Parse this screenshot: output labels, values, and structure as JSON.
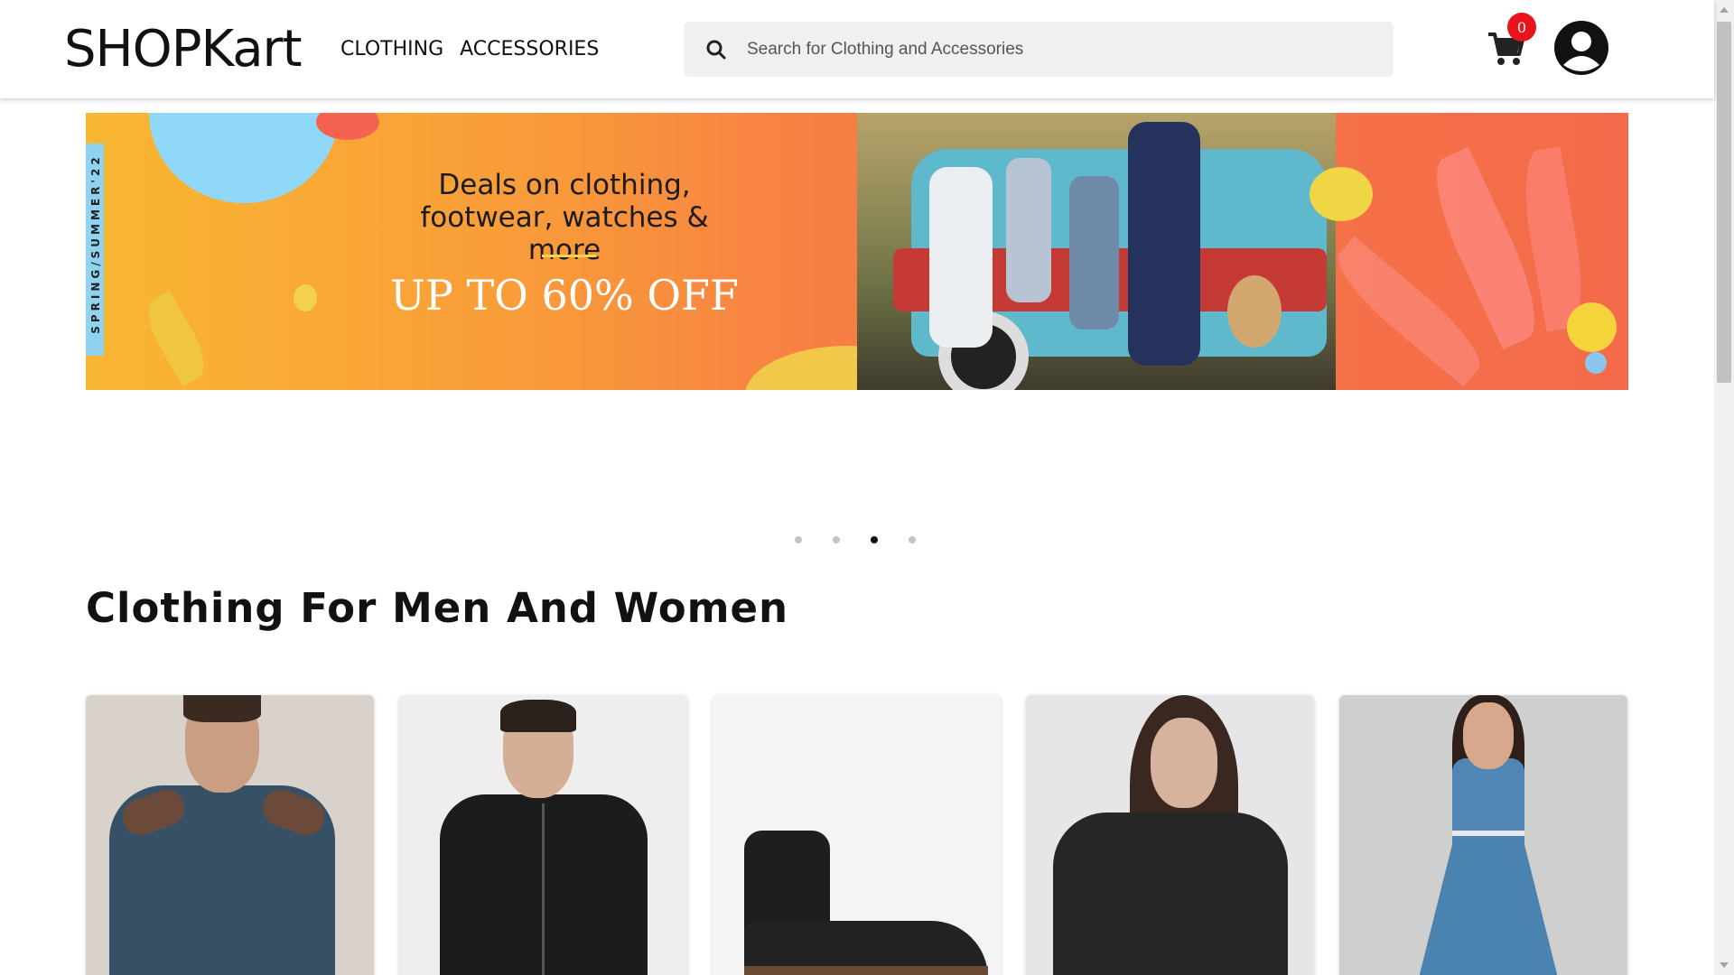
{
  "header": {
    "logo": "SHOPKart",
    "nav": [
      "CLOTHING",
      "ACCESSORIES"
    ],
    "search_placeholder": "Search for Clothing and Accessories",
    "cart_count": "0"
  },
  "banner": {
    "side_text": "SPRING/SUMMER'22",
    "headline": "Deals on clothing, footwear, watches & more",
    "offer": "UP TO 60% OFF"
  },
  "carousel": {
    "slides": 4,
    "active_index": 3
  },
  "section": {
    "title": "Clothing For Men And Women"
  },
  "products": [
    {
      "name": "men-sweater",
      "image": "blue sweater"
    },
    {
      "name": "men-jacket",
      "image": "black zip jacket"
    },
    {
      "name": "boot",
      "image": "black leather chelsea boot"
    },
    {
      "name": "women-leather-jacket",
      "image": "black leather biker jacket"
    },
    {
      "name": "denim-dress",
      "image": "blue denim dress"
    }
  ],
  "colors": {
    "accent_badge": "#e8131b",
    "banner_orange": "#f99a3a"
  }
}
